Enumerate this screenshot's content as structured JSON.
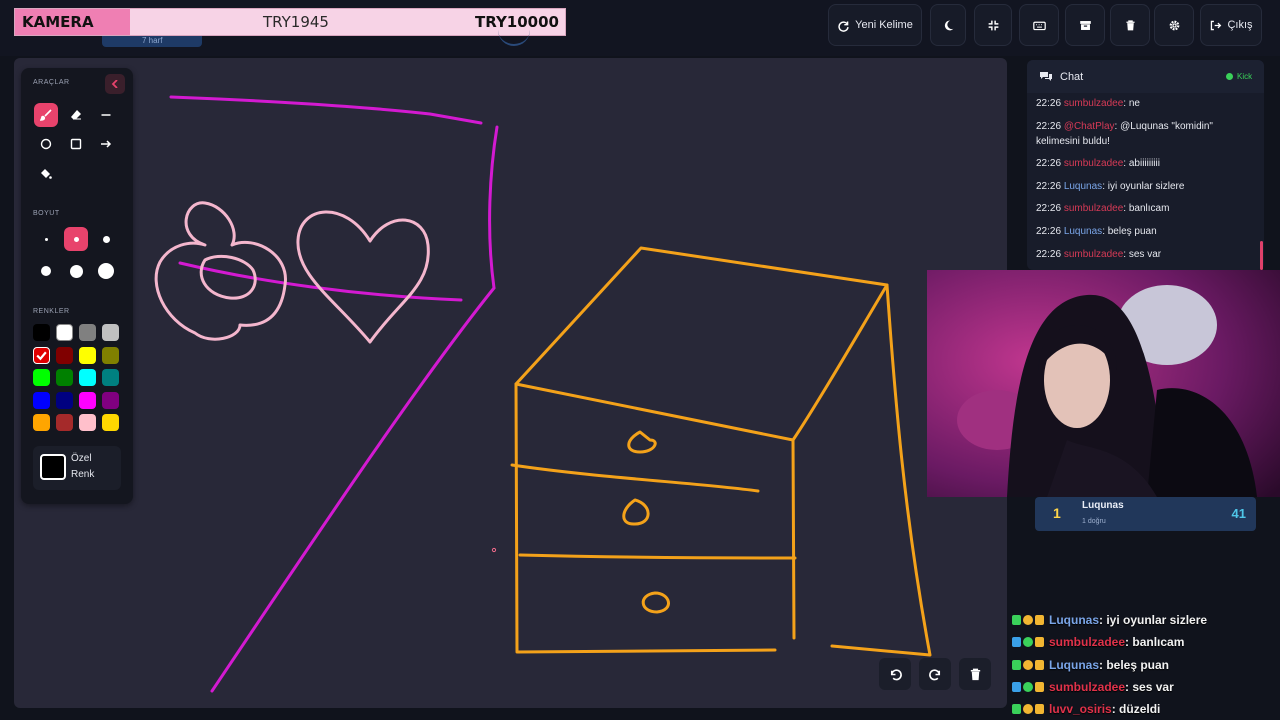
{
  "banner": {
    "left": "KAMERA",
    "middle": "TRY1945",
    "right": "TRY10000"
  },
  "hidden_chip": "7 harf",
  "top_buttons": {
    "new_word": "Yeni Kelime",
    "exit": "Çıkış",
    "theme_icon": "moon-icon",
    "fullscreen_icon": "compress-icon",
    "keyboard_icon": "keyboard-icon",
    "archive_icon": "archive-icon",
    "trash_icon": "trash-icon",
    "settings_icon": "gear-icon"
  },
  "tools": {
    "section_tools": "ARAÇLAR",
    "section_size": "BOYUT",
    "section_colors": "RENKLER",
    "custom_color_label": "Özel Renk",
    "colors": [
      "#000000",
      "#ffffff",
      "#808080",
      "#c0c0c0",
      "#e00000",
      "#800000",
      "#ffff00",
      "#808000",
      "#00ff00",
      "#008000",
      "#00ffff",
      "#008080",
      "#0000ff",
      "#000080",
      "#ff00ff",
      "#800080",
      "#ffa500",
      "#a52a2a",
      "#ffc0cb",
      "#ffd700"
    ],
    "selected_color": "#e00000"
  },
  "chat": {
    "title": "Chat",
    "status": "Kick",
    "messages": [
      {
        "time": "22:26",
        "user": "sumbulzadee",
        "color": "#d63a56",
        "text": ": ne"
      },
      {
        "time": "22:26",
        "user": "@ChatPlay",
        "color": "#d63a56",
        "text": ": @Luqunas \"komidin\" kelimesini buldu!"
      },
      {
        "time": "22:26",
        "user": "sumbulzadee",
        "color": "#d63a56",
        "text": ": abiiiiiiiii"
      },
      {
        "time": "22:26",
        "user": "Luqunas",
        "color": "#7aa5e8",
        "text": ": iyi oyunlar sizlere"
      },
      {
        "time": "22:26",
        "user": "sumbulzadee",
        "color": "#d63a56",
        "text": ": banlıcam"
      },
      {
        "time": "22:26",
        "user": "Luqunas",
        "color": "#7aa5e8",
        "text": ": beleş puan"
      },
      {
        "time": "22:26",
        "user": "sumbulzadee",
        "color": "#d63a56",
        "text": ": ses var"
      }
    ]
  },
  "leaderboard": [
    {
      "rank": "1",
      "name": "Luqunas",
      "sub": "1 doğru",
      "score": "41"
    }
  ],
  "overlay_chat": [
    {
      "user": "Luqunas",
      "color": "#7aa5e8",
      "text": ": iyi oyunlar sizlere"
    },
    {
      "user": "sumbulzadee",
      "color": "#e0324a",
      "text": ": banlıcam"
    },
    {
      "user": "Luqunas",
      "color": "#7aa5e8",
      "text": ": beleş puan"
    },
    {
      "user": "sumbulzadee",
      "color": "#e0324a",
      "text": ": ses var"
    },
    {
      "user": "luvv_osiris",
      "color": "#e0324a",
      "text": ": düzeldi"
    }
  ]
}
